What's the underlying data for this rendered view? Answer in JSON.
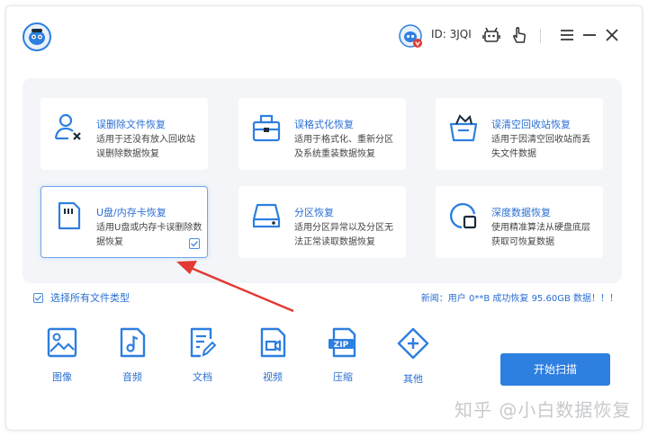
{
  "header": {
    "user_id": "ID: 3JQI"
  },
  "modes": [
    {
      "title": "误删除文件恢复",
      "desc": "适用于还没有放入回收站误删除数据恢复",
      "icon": "user-delete-icon",
      "selected": false
    },
    {
      "title": "误格式化恢复",
      "desc": "适用于格式化、重新分区及系统重装数据恢复",
      "icon": "format-icon",
      "selected": false
    },
    {
      "title": "误清空回收站恢复",
      "desc": "适用于因清空回收站而丢失文件数据",
      "icon": "recycle-bin-icon",
      "selected": false
    },
    {
      "title": "U盘/内存卡恢复",
      "desc": "适用U盘或内存卡误删除数据恢复",
      "icon": "sd-card-icon",
      "selected": true
    },
    {
      "title": "分区恢复",
      "desc": "适用分区异常以及分区无法正常读取数据恢复",
      "icon": "disk-partition-icon",
      "selected": false
    },
    {
      "title": "深度数据恢复",
      "desc": "使用精准算法从硬盘底层获取可恢复数据",
      "icon": "deep-scan-icon",
      "selected": false
    }
  ],
  "select_all_label": "选择所有文件类型",
  "news_text": "新闻：用户 0**B 成功恢复 95.60GB 数据！！！",
  "file_types": [
    {
      "label": "图像",
      "icon": "image-icon"
    },
    {
      "label": "音频",
      "icon": "audio-icon"
    },
    {
      "label": "文档",
      "icon": "document-icon"
    },
    {
      "label": "视频",
      "icon": "video-icon"
    },
    {
      "label": "压缩",
      "icon": "zip-icon"
    },
    {
      "label": "其他",
      "icon": "other-icon"
    }
  ],
  "scan_button": "开始扫描",
  "watermark": "知乎 @小白数据恢复",
  "colors": {
    "accent": "#2d7fe0",
    "text_blue": "#2a6fd3",
    "panel_bg": "#f3f5f8",
    "arrow": "#e23a34"
  }
}
